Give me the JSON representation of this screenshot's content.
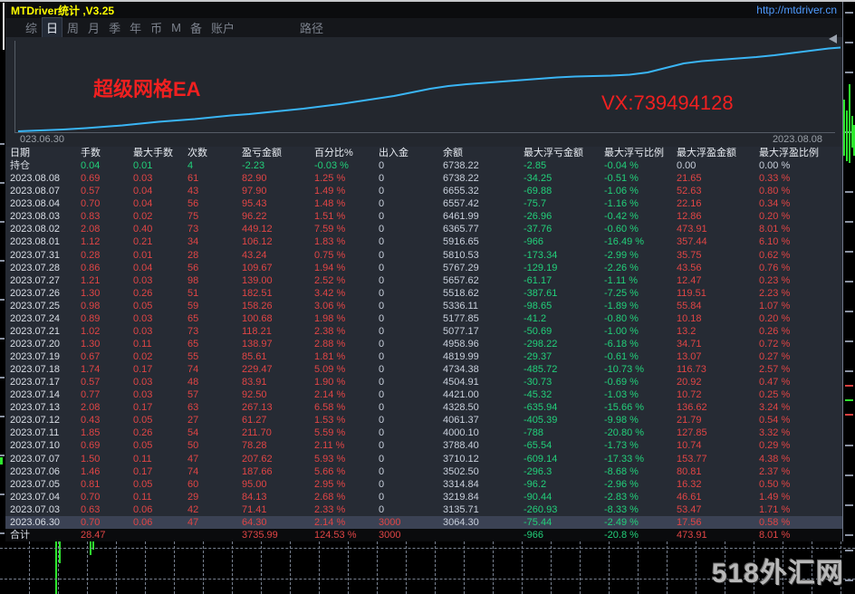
{
  "window": {
    "title": "MTDriver统计 ,V3.25",
    "url": "http://mtdriver.cn"
  },
  "menu": {
    "items": [
      {
        "label": "综",
        "active": false
      },
      {
        "label": "日",
        "active": true
      },
      {
        "label": "周",
        "active": false
      },
      {
        "label": "月",
        "active": false
      },
      {
        "label": "季",
        "active": false
      },
      {
        "label": "年",
        "active": false
      },
      {
        "label": "币",
        "active": false
      },
      {
        "label": "M",
        "active": false
      },
      {
        "label": "备",
        "active": false
      },
      {
        "label": "账户",
        "active": false
      },
      {
        "label": "路径",
        "active": false,
        "gap": true
      }
    ]
  },
  "chart": {
    "annotation_left": "超级网格EA",
    "annotation_right": "VX:739494128",
    "date_start": "023.06.30",
    "date_end": "2023.08.08",
    "line_color": "#3ab5f5",
    "curve_points": [
      [
        14,
        104
      ],
      [
        39,
        103
      ],
      [
        64,
        102
      ],
      [
        89,
        100.5
      ],
      [
        109,
        99
      ],
      [
        129,
        97.5
      ],
      [
        149,
        95.5
      ],
      [
        169,
        93.5
      ],
      [
        189,
        92
      ],
      [
        209,
        90.5
      ],
      [
        229,
        88.5
      ],
      [
        249,
        86.5
      ],
      [
        269,
        85
      ],
      [
        289,
        83
      ],
      [
        309,
        81
      ],
      [
        329,
        79
      ],
      [
        349,
        76.5
      ],
      [
        369,
        74
      ],
      [
        389,
        71
      ],
      [
        409,
        68
      ],
      [
        429,
        65
      ],
      [
        449,
        61
      ],
      [
        469,
        57
      ],
      [
        489,
        54
      ],
      [
        509,
        52
      ],
      [
        529,
        50.5
      ],
      [
        549,
        49
      ],
      [
        569,
        47.5
      ],
      [
        589,
        46
      ],
      [
        609,
        44.5
      ],
      [
        629,
        43.5
      ],
      [
        649,
        43
      ],
      [
        669,
        42.5
      ],
      [
        689,
        41.5
      ],
      [
        709,
        39
      ],
      [
        729,
        34
      ],
      [
        749,
        29
      ],
      [
        769,
        26.5
      ],
      [
        789,
        25
      ],
      [
        809,
        23.5
      ],
      [
        829,
        22
      ],
      [
        849,
        20
      ],
      [
        869,
        17.5
      ],
      [
        889,
        15
      ],
      [
        909,
        12.5
      ],
      [
        922,
        11.5
      ]
    ]
  },
  "watermark": "518外汇网",
  "table": {
    "columns": [
      "日期",
      "手数",
      "最大手数",
      "次数",
      "盈亏金额",
      "百分比%",
      "出入金",
      "余额",
      "最大浮亏金额",
      "最大浮亏比例",
      "最大浮盈金额",
      "最大浮盈比例"
    ],
    "cell_colors": {
      "position": [
        "date",
        "g",
        "g",
        "g",
        "g",
        "g",
        "w",
        "w",
        "g",
        "g",
        "w",
        "w"
      ],
      "day": [
        "date",
        "r",
        "r",
        "r",
        "r",
        "r",
        "wz",
        "w",
        "g",
        "g",
        "r",
        "r"
      ],
      "total": [
        "date",
        "r",
        "r",
        "r",
        "r",
        "r",
        "r",
        "w",
        "g",
        "g",
        "r",
        "r"
      ]
    },
    "rows": [
      {
        "type": "position",
        "cells": [
          "持仓",
          "0.04",
          "0.01",
          "4",
          "-2.23",
          "-0.03 %",
          "0",
          "6738.22",
          "-2.85",
          "-0.04 %",
          "0.00",
          "0.00 %"
        ]
      },
      {
        "type": "day",
        "cells": [
          "2023.08.08",
          "0.69",
          "0.03",
          "61",
          "82.90",
          "1.25 %",
          "0",
          "6738.22",
          "-34.25",
          "-0.51 %",
          "21.65",
          "0.33 %"
        ]
      },
      {
        "type": "day",
        "cells": [
          "2023.08.07",
          "0.57",
          "0.04",
          "43",
          "97.90",
          "1.49 %",
          "0",
          "6655.32",
          "-69.88",
          "-1.06 %",
          "52.63",
          "0.80 %"
        ]
      },
      {
        "type": "day",
        "cells": [
          "2023.08.04",
          "0.70",
          "0.04",
          "56",
          "95.43",
          "1.48 %",
          "0",
          "6557.42",
          "-75.7",
          "-1.16 %",
          "22.16",
          "0.34 %"
        ]
      },
      {
        "type": "day",
        "cells": [
          "2023.08.03",
          "0.83",
          "0.02",
          "75",
          "96.22",
          "1.51 %",
          "0",
          "6461.99",
          "-26.96",
          "-0.42 %",
          "12.86",
          "0.20 %"
        ]
      },
      {
        "type": "day",
        "cells": [
          "2023.08.02",
          "2.08",
          "0.40",
          "73",
          "449.12",
          "7.59 %",
          "0",
          "6365.77",
          "-37.76",
          "-0.60 %",
          "473.91",
          "8.01 %"
        ]
      },
      {
        "type": "day",
        "cells": [
          "2023.08.01",
          "1.12",
          "0.21",
          "34",
          "106.12",
          "1.83 %",
          "0",
          "5916.65",
          "-966",
          "-16.49 %",
          "357.44",
          "6.10 %"
        ]
      },
      {
        "type": "day",
        "cells": [
          "2023.07.31",
          "0.28",
          "0.01",
          "28",
          "43.24",
          "0.75 %",
          "0",
          "5810.53",
          "-173.34",
          "-2.99 %",
          "35.75",
          "0.62 %"
        ]
      },
      {
        "type": "day",
        "cells": [
          "2023.07.28",
          "0.86",
          "0.04",
          "56",
          "109.67",
          "1.94 %",
          "0",
          "5767.29",
          "-129.19",
          "-2.26 %",
          "43.56",
          "0.76 %"
        ]
      },
      {
        "type": "day",
        "cells": [
          "2023.07.27",
          "1.21",
          "0.03",
          "98",
          "139.00",
          "2.52 %",
          "0",
          "5657.62",
          "-61.17",
          "-1.11 %",
          "12.47",
          "0.23 %"
        ]
      },
      {
        "type": "day",
        "cells": [
          "2023.07.26",
          "1.30",
          "0.26",
          "51",
          "182.51",
          "3.42 %",
          "0",
          "5518.62",
          "-387.61",
          "-7.25 %",
          "119.51",
          "2.23 %"
        ]
      },
      {
        "type": "day",
        "cells": [
          "2023.07.25",
          "0.98",
          "0.05",
          "59",
          "158.26",
          "3.06 %",
          "0",
          "5336.11",
          "-98.65",
          "-1.89 %",
          "55.84",
          "1.07 %"
        ]
      },
      {
        "type": "day",
        "cells": [
          "2023.07.24",
          "0.89",
          "0.03",
          "65",
          "100.68",
          "1.98 %",
          "0",
          "5177.85",
          "-41.2",
          "-0.80 %",
          "10.18",
          "0.20 %"
        ]
      },
      {
        "type": "day",
        "cells": [
          "2023.07.21",
          "1.02",
          "0.03",
          "73",
          "118.21",
          "2.38 %",
          "0",
          "5077.17",
          "-50.69",
          "-1.00 %",
          "13.2",
          "0.26 %"
        ]
      },
      {
        "type": "day",
        "cells": [
          "2023.07.20",
          "1.30",
          "0.11",
          "65",
          "138.97",
          "2.88 %",
          "0",
          "4958.96",
          "-298.22",
          "-6.18 %",
          "34.71",
          "0.72 %"
        ]
      },
      {
        "type": "day",
        "cells": [
          "2023.07.19",
          "0.67",
          "0.02",
          "55",
          "85.61",
          "1.81 %",
          "0",
          "4819.99",
          "-29.37",
          "-0.61 %",
          "13.07",
          "0.27 %"
        ]
      },
      {
        "type": "day",
        "cells": [
          "2023.07.18",
          "1.74",
          "0.17",
          "74",
          "229.47",
          "5.09 %",
          "0",
          "4734.38",
          "-485.72",
          "-10.73 %",
          "116.73",
          "2.57 %"
        ]
      },
      {
        "type": "day",
        "cells": [
          "2023.07.17",
          "0.57",
          "0.03",
          "48",
          "83.91",
          "1.90 %",
          "0",
          "4504.91",
          "-30.73",
          "-0.69 %",
          "20.92",
          "0.47 %"
        ]
      },
      {
        "type": "day",
        "cells": [
          "2023.07.14",
          "0.77",
          "0.03",
          "57",
          "92.50",
          "2.14 %",
          "0",
          "4421.00",
          "-45.32",
          "-1.03 %",
          "10.72",
          "0.25 %"
        ]
      },
      {
        "type": "day",
        "cells": [
          "2023.07.13",
          "2.08",
          "0.17",
          "63",
          "267.13",
          "6.58 %",
          "0",
          "4328.50",
          "-635.94",
          "-15.66 %",
          "136.62",
          "3.24 %"
        ]
      },
      {
        "type": "day",
        "cells": [
          "2023.07.12",
          "0.43",
          "0.05",
          "27",
          "61.27",
          "1.53 %",
          "0",
          "4061.37",
          "-405.39",
          "-9.98 %",
          "21.79",
          "0.54 %"
        ]
      },
      {
        "type": "day",
        "cells": [
          "2023.07.11",
          "1.85",
          "0.26",
          "54",
          "211.70",
          "5.59 %",
          "0",
          "4000.10",
          "-788",
          "-20.80 %",
          "127.85",
          "3.32 %"
        ]
      },
      {
        "type": "day",
        "cells": [
          "2023.07.10",
          "0.69",
          "0.05",
          "50",
          "78.28",
          "2.11 %",
          "0",
          "3788.40",
          "-65.54",
          "-1.73 %",
          "10.74",
          "0.29 %"
        ]
      },
      {
        "type": "day",
        "cells": [
          "2023.07.07",
          "1.50",
          "0.11",
          "47",
          "207.62",
          "5.93 %",
          "0",
          "3710.12",
          "-609.14",
          "-17.33 %",
          "153.77",
          "4.38 %"
        ]
      },
      {
        "type": "day",
        "cells": [
          "2023.07.06",
          "1.46",
          "0.17",
          "74",
          "187.66",
          "5.66 %",
          "0",
          "3502.50",
          "-296.3",
          "-8.68 %",
          "80.81",
          "2.37 %"
        ]
      },
      {
        "type": "day",
        "cells": [
          "2023.07.05",
          "0.81",
          "0.05",
          "60",
          "95.00",
          "2.95 %",
          "0",
          "3314.84",
          "-96.2",
          "-2.96 %",
          "16.32",
          "0.50 %"
        ]
      },
      {
        "type": "day",
        "cells": [
          "2023.07.04",
          "0.70",
          "0.11",
          "29",
          "84.13",
          "2.68 %",
          "0",
          "3219.84",
          "-90.44",
          "-2.83 %",
          "46.61",
          "1.49 %"
        ]
      },
      {
        "type": "day",
        "cells": [
          "2023.07.03",
          "0.63",
          "0.06",
          "42",
          "71.41",
          "2.33 %",
          "0",
          "3135.71",
          "-260.93",
          "-8.33 %",
          "53.47",
          "1.71 %"
        ]
      },
      {
        "type": "day",
        "highlight": true,
        "cells": [
          "2023.06.30",
          "0.70",
          "0.06",
          "47",
          "64.30",
          "2.14 %",
          "3000",
          "3064.30",
          "-75.44",
          "-2.49 %",
          "17.56",
          "0.58 %"
        ]
      },
      {
        "type": "total",
        "cells": [
          "合计",
          "28.47",
          "",
          "",
          "3735.99",
          "124.53 %",
          "3000",
          "",
          "-966",
          "-20.8 %",
          "473.91",
          "8.01 %"
        ]
      }
    ]
  },
  "backdrop": {
    "footer_bars": [
      [
        61,
        598,
        2,
        58
      ],
      [
        65,
        598,
        2,
        24
      ],
      [
        99,
        598,
        2,
        15
      ],
      [
        102,
        598,
        2,
        9
      ]
    ],
    "right_bars": [
      [
        931,
        110,
        2,
        62
      ],
      [
        934,
        122,
        2,
        56
      ],
      [
        937,
        93,
        2,
        87
      ],
      [
        940,
        128,
        2,
        35
      ],
      [
        942,
        138,
        2,
        34
      ]
    ],
    "right_dashes_gray": [
      13,
      46,
      79,
      145,
      211,
      244,
      277,
      310,
      343,
      376,
      409,
      491,
      524,
      557,
      590,
      607,
      640
    ],
    "right_dashes_red": [
      425,
      457
    ],
    "right_dashes_green": [
      441
    ],
    "left_dashes": [
      158,
      201,
      244,
      287,
      330,
      373,
      416,
      459,
      502,
      545,
      588
    ],
    "left_green_tick": [
      0,
      505,
      3,
      8
    ],
    "grid": {
      "h_lines": [
        605,
        639
      ],
      "v_start": 32,
      "v_step": 32,
      "v_end": 928
    }
  }
}
